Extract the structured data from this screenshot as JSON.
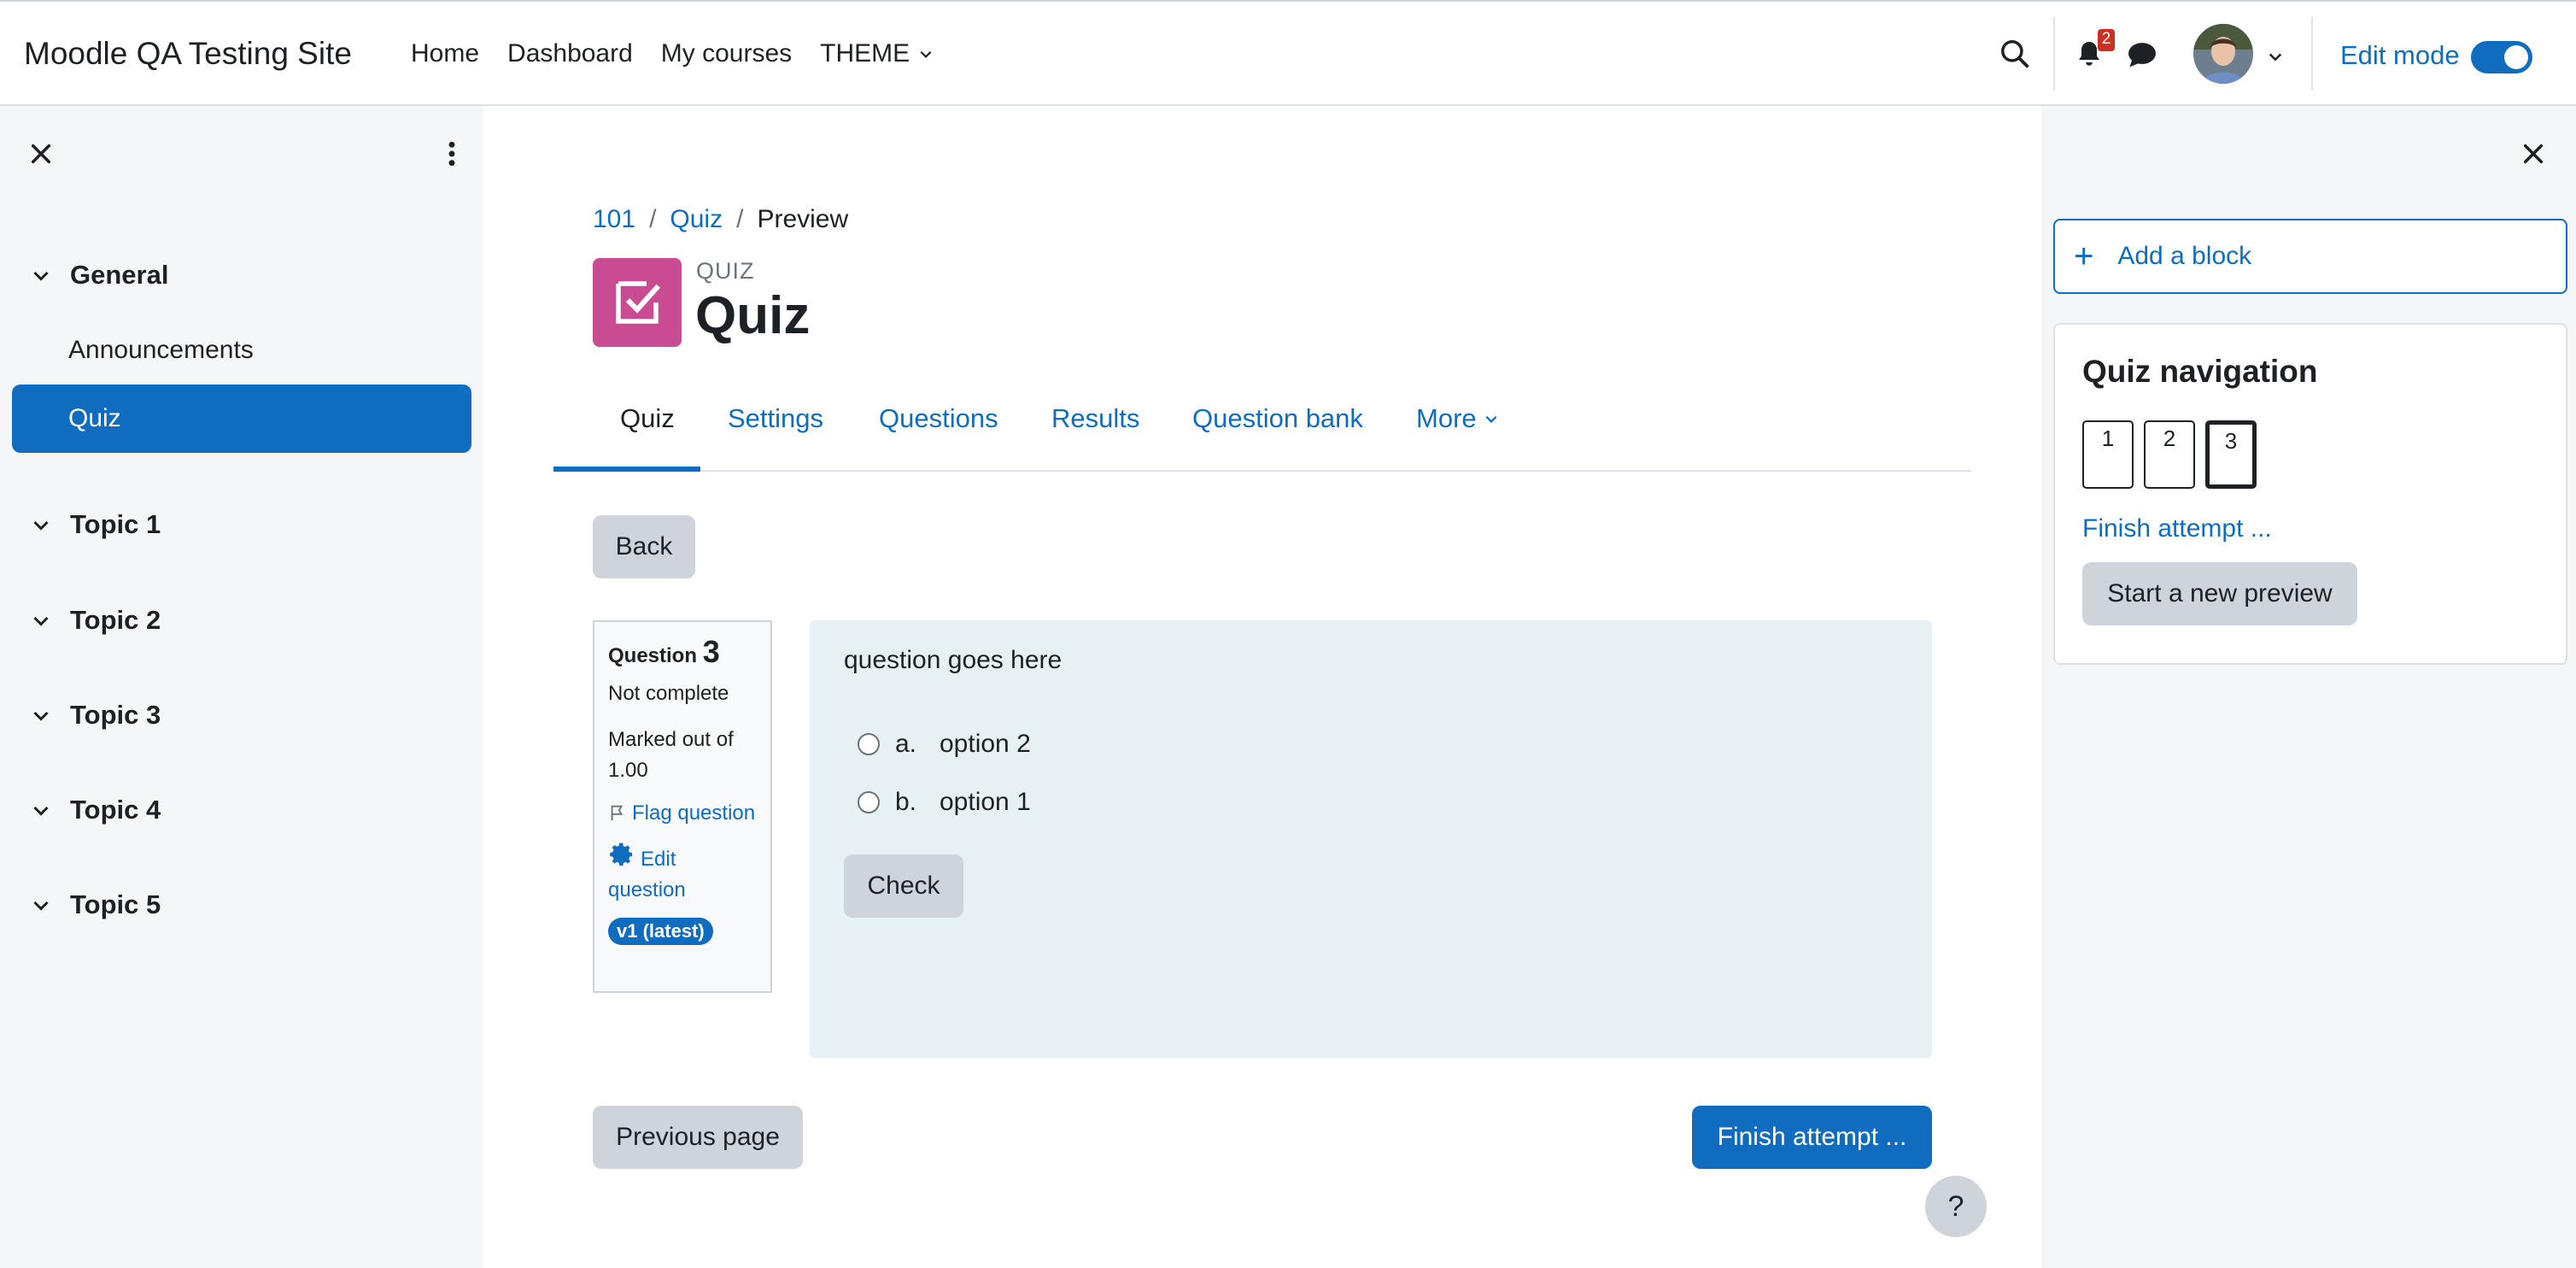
{
  "site": {
    "name": "Moodle QA Testing Site"
  },
  "primary_nav": {
    "home": "Home",
    "dashboard": "Dashboard",
    "my_courses": "My courses",
    "theme": "THEME"
  },
  "notifications": {
    "count": "2"
  },
  "edit_mode": {
    "label": "Edit mode",
    "enabled": true
  },
  "course_index": {
    "general": "General",
    "announcements": "Announcements",
    "quiz": "Quiz",
    "topic1": "Topic 1",
    "topic2": "Topic 2",
    "topic3": "Topic 3",
    "topic4": "Topic 4",
    "topic5": "Topic 5"
  },
  "breadcrumb": {
    "c1": "101",
    "c2": "Quiz",
    "c3": "Preview",
    "sep": "/"
  },
  "header": {
    "activity_type": "QUIZ",
    "title": "Quiz"
  },
  "tabs": {
    "quiz": "Quiz",
    "settings": "Settings",
    "questions": "Questions",
    "results": "Results",
    "question_bank": "Question bank",
    "more": "More"
  },
  "back_label": "Back",
  "question_info": {
    "label": "Question",
    "number": "3",
    "state": "Not complete",
    "grade": "Marked out of 1.00",
    "flag": "Flag question",
    "edit": "Edit question",
    "version": "v1 (latest)"
  },
  "question": {
    "text": "question goes here",
    "answers": [
      {
        "letter": "a.",
        "text": "option 2"
      },
      {
        "letter": "b.",
        "text": "option 1"
      }
    ],
    "check_label": "Check"
  },
  "nav_buttons": {
    "previous": "Previous page",
    "finish": "Finish attempt ..."
  },
  "help_label": "?",
  "right_drawer": {
    "add_block": "Add a block",
    "block_title": "Quiz navigation",
    "question_buttons": [
      "1",
      "2",
      "3"
    ],
    "finish_link": "Finish attempt ...",
    "new_preview": "Start a new preview"
  },
  "colors": {
    "brand": "#0f6cbf",
    "quiz_icon": "#c94b91",
    "badge": "#ca3120"
  }
}
